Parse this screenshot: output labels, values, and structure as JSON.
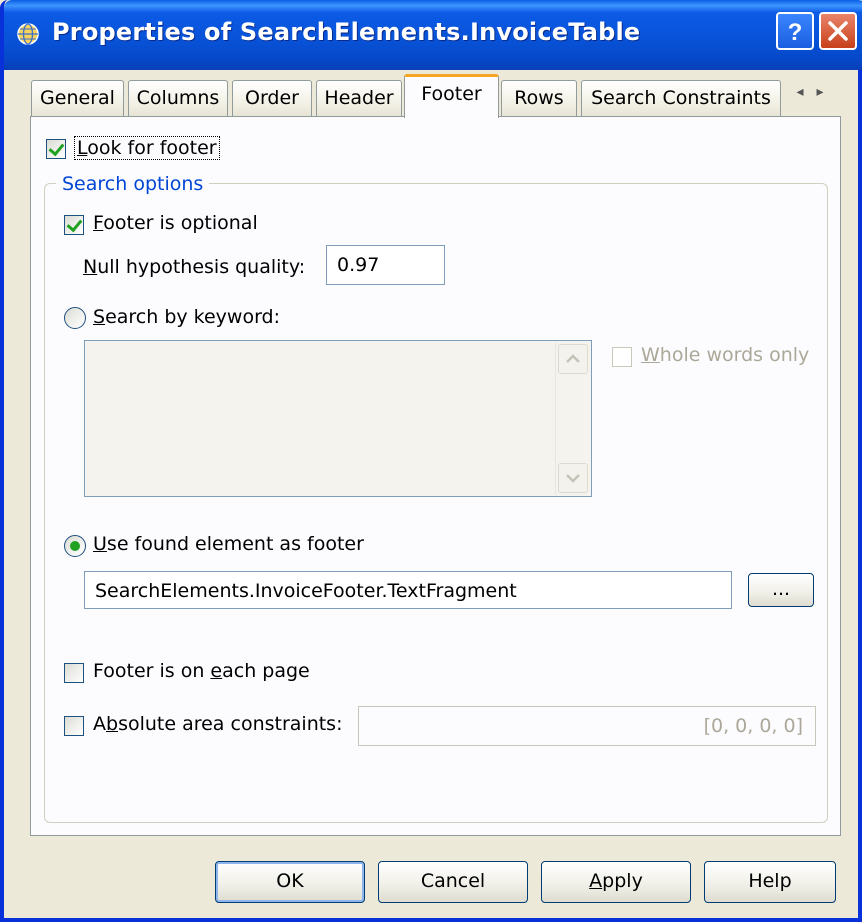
{
  "window": {
    "title": "Properties of SearchElements.InvoiceTable",
    "icon": "globe-icon",
    "help_button": "?",
    "close_button": "✕"
  },
  "tabs": [
    {
      "label": "General"
    },
    {
      "label": "Columns"
    },
    {
      "label": "Order"
    },
    {
      "label": "Header"
    },
    {
      "label": "Footer",
      "active": true
    },
    {
      "label": "Rows"
    },
    {
      "label": "Search Constraints"
    }
  ],
  "tab_scroll": {
    "left": "◂",
    "right": "▸"
  },
  "footer_tab": {
    "look_for_footer": {
      "label_u": "L",
      "label_rest": "ook for footer",
      "checked": true
    },
    "group_title": "Search options",
    "footer_optional": {
      "label_u": "F",
      "label_rest": "ooter is optional",
      "checked": true
    },
    "null_hypothesis": {
      "label_u": "N",
      "label_rest": "ull hypothesis quality:",
      "value": "0.97"
    },
    "search_by_keyword": {
      "label_u": "S",
      "label_rest": "earch by keyword:",
      "selected": false
    },
    "keyword_text": "",
    "whole_words_only": {
      "label_u": "W",
      "label_rest": "hole words only",
      "checked": false,
      "enabled": false
    },
    "use_found_element": {
      "label_u": "U",
      "label_rest": "se found element as footer",
      "selected": true
    },
    "found_element_value": "SearchElements.InvoiceFooter.TextFragment",
    "browse_button": "...",
    "footer_each_page": {
      "label_pre": "Footer is on ",
      "label_u": "e",
      "label_rest": "ach page",
      "checked": false
    },
    "absolute_area": {
      "label_pre": "A",
      "label_u": "b",
      "label_rest": "solute area constraints:",
      "checked": false,
      "value": "[0, 0, 0, 0]"
    }
  },
  "buttons": {
    "ok": "OK",
    "cancel": "Cancel",
    "apply_u": "A",
    "apply_rest": "pply",
    "help": "Help"
  },
  "colors": {
    "title_bar": "#0853d8",
    "dialog_bg": "#ece9d8",
    "group_title": "#0046d5",
    "check_mark": "#21a121",
    "active_tab_accent": "#f5a623"
  }
}
